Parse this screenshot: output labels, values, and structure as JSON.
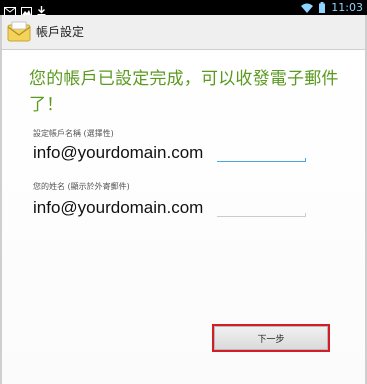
{
  "status_bar": {
    "time": "11:03",
    "left_icons": [
      "mail-icon",
      "image-icon",
      "download-icon"
    ],
    "right_icons": [
      "wifi-icon",
      "battery-icon"
    ],
    "time_color": "#8fd3ff"
  },
  "action_bar": {
    "title": "帳戶設定",
    "icon": "mail-envelope-icon"
  },
  "main": {
    "heading": "您的帳戶已設定完成，可以收發電子郵件了！",
    "heading_color": "#5a9a1f",
    "account_name": {
      "label": "設定帳戶名稱 (選擇性)",
      "value": "info@yourdomain.com"
    },
    "your_name": {
      "label": "您的姓名 (顯示於外寄郵件)",
      "value": "info@yourdomain.com"
    },
    "next_button": "下一步",
    "highlight_color": "#d21f26"
  }
}
